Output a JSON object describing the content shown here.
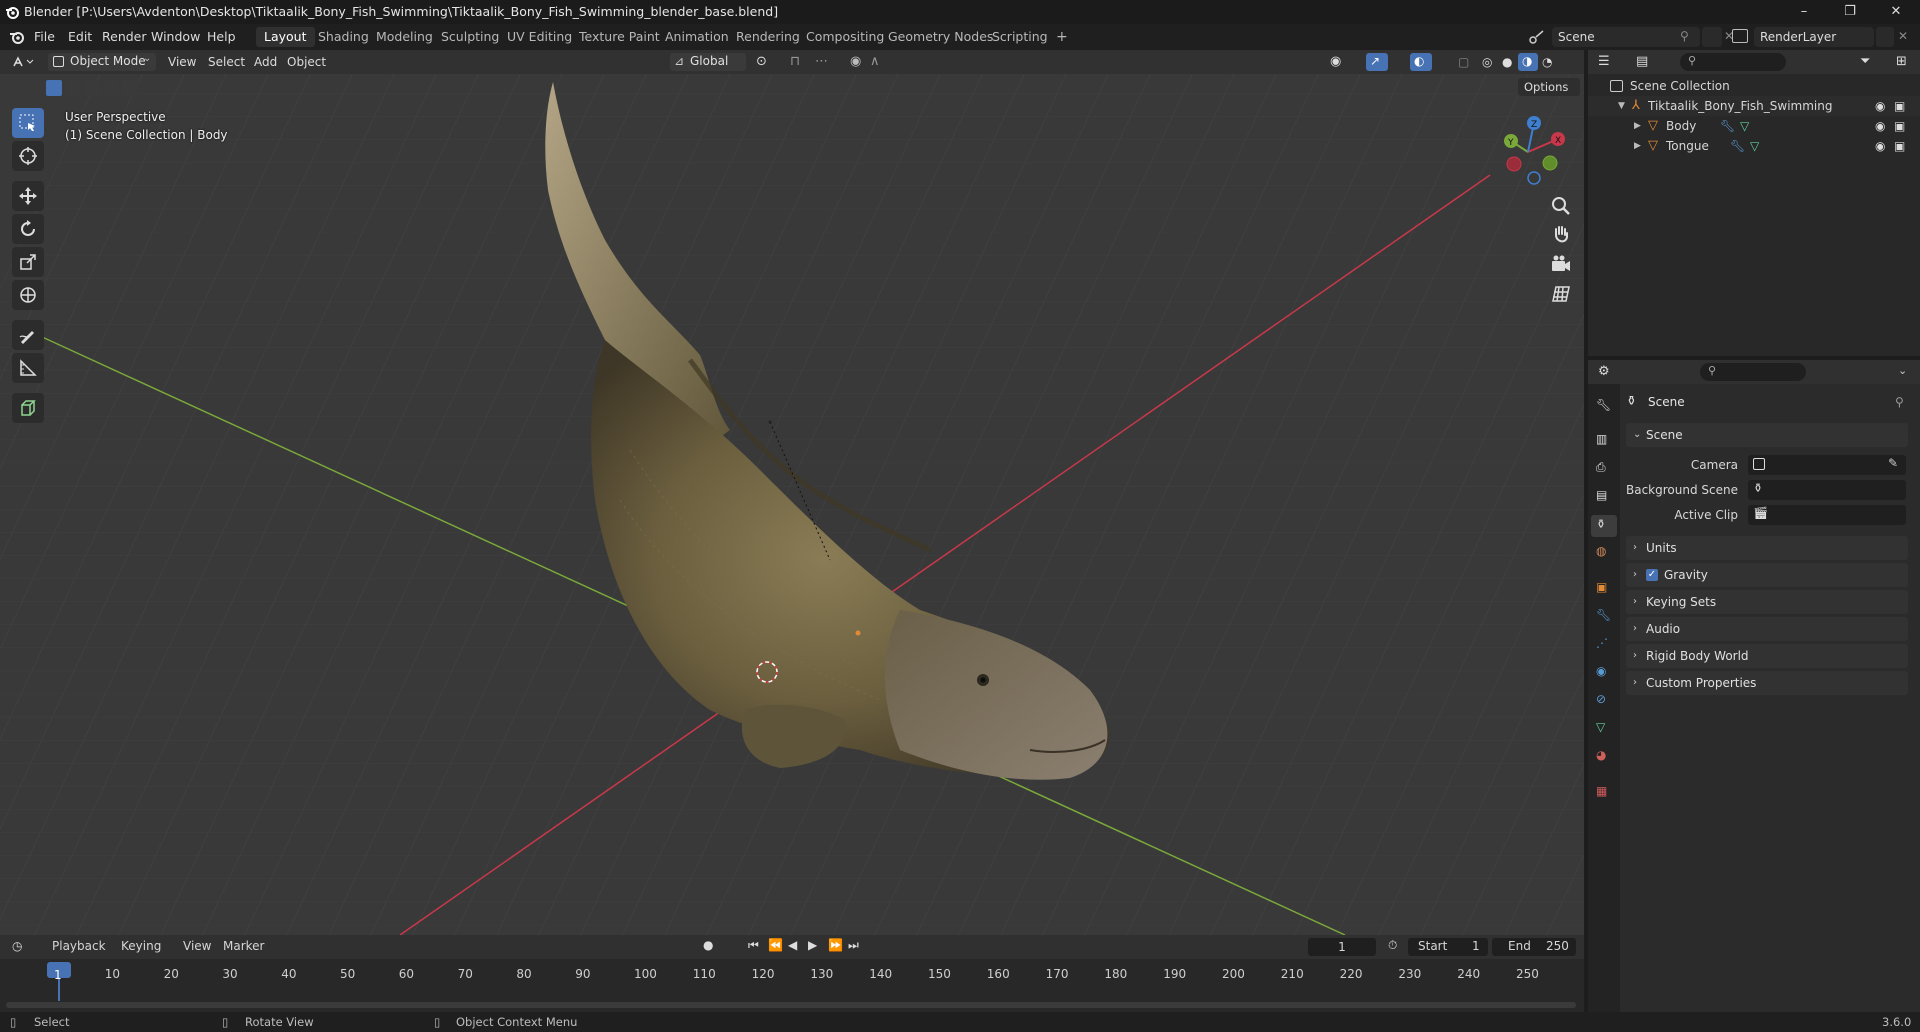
{
  "window": {
    "title": "Blender [P:\\Users\\Avdenton\\Desktop\\Tiktaalik_Bony_Fish_Swimming\\Tiktaalik_Bony_Fish_Swimming_blender_base.blend]",
    "minimize": "–",
    "maximize": "❐",
    "close": "✕"
  },
  "menu": [
    "File",
    "Edit",
    "Render",
    "Window",
    "Help"
  ],
  "workspaces": [
    "Layout",
    "Shading",
    "Modeling",
    "Sculpting",
    "UV Editing",
    "Texture Paint",
    "Animation",
    "Rendering",
    "Compositing",
    "Geometry Nodes",
    "Scripting"
  ],
  "add_workspace": "+",
  "scene_name": "Scene",
  "render_layer": "RenderLayer",
  "viewport_header": {
    "mode": "Object Mode",
    "items": [
      "View",
      "Select",
      "Add",
      "Object"
    ],
    "orientation": "Global",
    "options": "Options"
  },
  "viewport": {
    "perspective": "User Perspective",
    "collection_info": "(1) Scene Collection | Body",
    "gizmo": {
      "x": "X",
      "y": "Y",
      "z": "Z"
    }
  },
  "outliner": {
    "root": "Scene Collection",
    "items": [
      {
        "name": "Tiktaalik_Bony_Fish_Swimming"
      },
      {
        "name": "Body"
      },
      {
        "name": "Tongue"
      }
    ]
  },
  "properties": {
    "context": "Scene",
    "section": "Scene",
    "labels": {
      "camera": "Camera",
      "background_scene": "Background Scene",
      "active_clip": "Active Clip"
    },
    "panels": [
      "Units",
      "Gravity",
      "Keying Sets",
      "Audio",
      "Rigid Body World",
      "Custom Properties"
    ],
    "gravity_enabled": true
  },
  "timeline": {
    "menus": [
      "Playback",
      "Keying",
      "View",
      "Marker"
    ],
    "current_frame": "1",
    "start_label": "Start",
    "start": "1",
    "end_label": "End",
    "end": "250",
    "ticks": [
      "1",
      "10",
      "20",
      "30",
      "40",
      "50",
      "60",
      "70",
      "80",
      "90",
      "100",
      "110",
      "120",
      "130",
      "140",
      "150",
      "160",
      "170",
      "180",
      "190",
      "200",
      "210",
      "220",
      "230",
      "240",
      "250"
    ]
  },
  "statusbar": {
    "select": "Select",
    "rotate": "Rotate View",
    "context_menu": "Object Context Menu",
    "version": "3.6.0"
  },
  "colors": {
    "accent": "#4772b3",
    "x_axis": "#c8384a",
    "y_axis": "#7aa83a",
    "z_axis": "#3f7fd0",
    "object_orange": "#e08a36"
  }
}
